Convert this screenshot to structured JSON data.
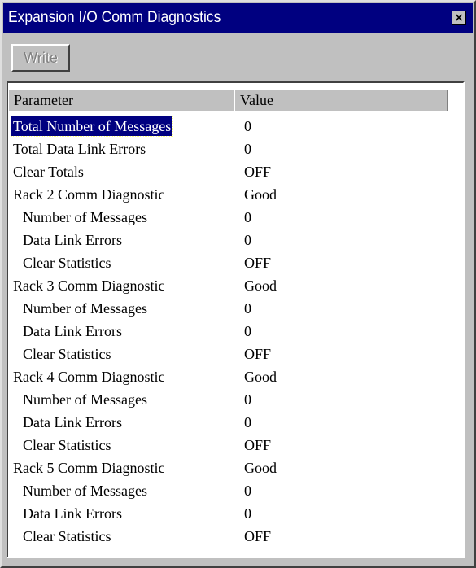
{
  "window": {
    "title": "Expansion I/O Comm Diagnostics",
    "close_glyph": "×"
  },
  "toolbar": {
    "write_label": "Write",
    "write_enabled": false
  },
  "grid": {
    "columns": [
      "Parameter",
      "Value"
    ],
    "selected_row": 0,
    "rows": [
      {
        "parameter": "Total Number of Messages",
        "value": "0",
        "indent": false
      },
      {
        "parameter": "Total Data Link Errors",
        "value": "0",
        "indent": false
      },
      {
        "parameter": "Clear Totals",
        "value": "OFF",
        "indent": false
      },
      {
        "parameter": "Rack 2 Comm Diagnostic",
        "value": "Good",
        "indent": false
      },
      {
        "parameter": "Number of Messages",
        "value": "0",
        "indent": true
      },
      {
        "parameter": "Data Link Errors",
        "value": "0",
        "indent": true
      },
      {
        "parameter": "Clear Statistics",
        "value": "OFF",
        "indent": true
      },
      {
        "parameter": "Rack 3 Comm Diagnostic",
        "value": "Good",
        "indent": false
      },
      {
        "parameter": "Number of Messages",
        "value": "0",
        "indent": true
      },
      {
        "parameter": "Data Link Errors",
        "value": "0",
        "indent": true
      },
      {
        "parameter": "Clear Statistics",
        "value": "OFF",
        "indent": true
      },
      {
        "parameter": "Rack 4 Comm Diagnostic",
        "value": "Good",
        "indent": false
      },
      {
        "parameter": "Number of Messages",
        "value": "0",
        "indent": true
      },
      {
        "parameter": "Data Link Errors",
        "value": "0",
        "indent": true
      },
      {
        "parameter": "Clear Statistics",
        "value": "OFF",
        "indent": true
      },
      {
        "parameter": "Rack 5 Comm Diagnostic",
        "value": "Good",
        "indent": false
      },
      {
        "parameter": "Number of Messages",
        "value": "0",
        "indent": true
      },
      {
        "parameter": "Data Link Errors",
        "value": "0",
        "indent": true
      },
      {
        "parameter": "Clear Statistics",
        "value": "OFF",
        "indent": true
      }
    ]
  },
  "colors": {
    "titlebar": "#000080",
    "face": "#c0c0c0",
    "selection": "#000080"
  },
  "icons": {
    "close": "close-icon"
  }
}
